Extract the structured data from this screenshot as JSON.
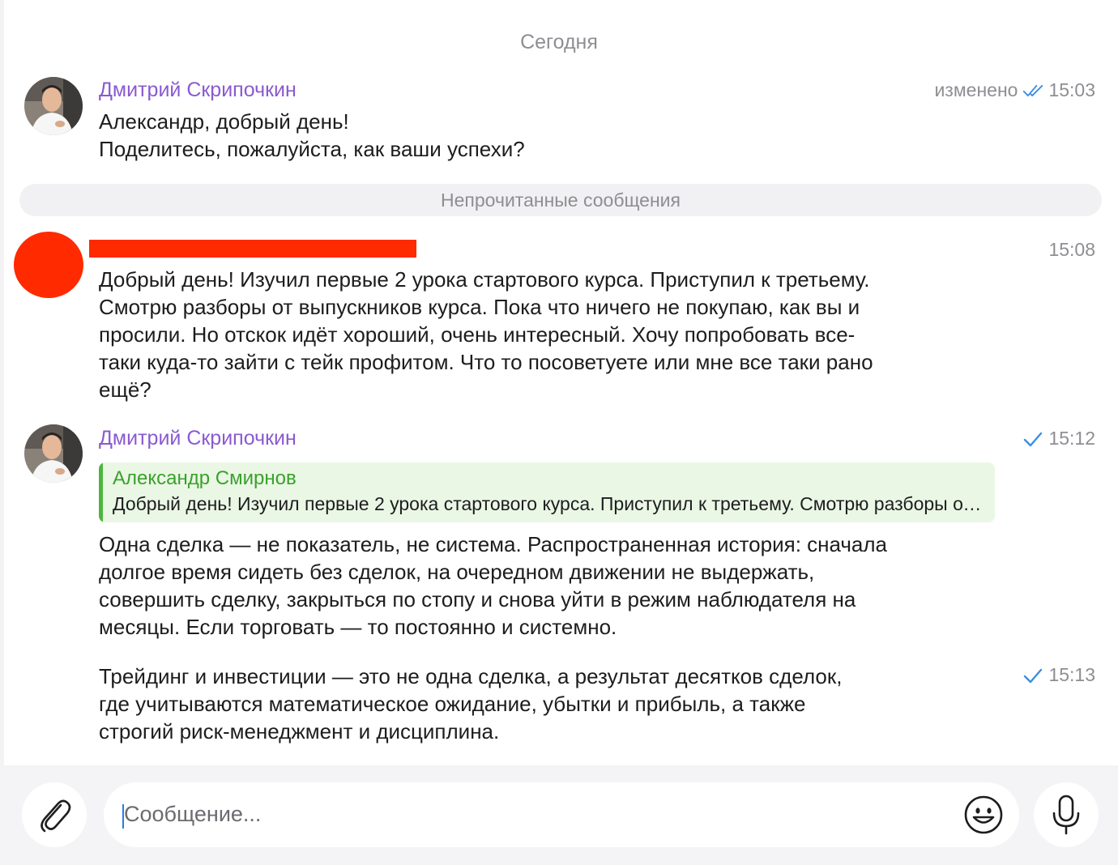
{
  "date_separator": "Сегодня",
  "unread_separator": "Непрочитанные сообщения",
  "messages": [
    {
      "sender": "Дмитрий Скрипочкин",
      "edited_label": "изменено",
      "time": "15:03",
      "status": "read",
      "text": "Александр, добрый день!\nПоделитесь, пожалуйста, как ваши успехи?"
    },
    {
      "sender": "",
      "time": "15:08",
      "text": "Добрый день! Изучил первые 2 урока стартового курса. Приступил к третьему.\nСмотрю разборы от выпускников курса. Пока что ничего не покупаю, как вы и\nпросили. Но отскок идёт хороший, очень интересный. Хочу попробовать все-\nтаки куда-то зайти с тейк профитом. Что то посоветуете или мне все таки рано\nещё?"
    },
    {
      "sender": "Дмитрий Скрипочкин",
      "time": "15:12",
      "status": "sent",
      "reply": {
        "name": "Александр Смирнов",
        "text": "Добрый день! Изучил первые 2 урока стартового курса. Приступил к третьему. Смотрю разборы от выпускников курса."
      },
      "text": "Одна сделка — не показатель, не система. Распространенная история: сначала\nдолгое время сидеть без сделок, на очередном движении не выдержать,\nсовершить сделку, закрыться по стопу и снова уйти в режим наблюдателя на\nмесяцы. Если торговать — то постоянно и системно."
    },
    {
      "time": "15:13",
      "status": "sent",
      "text": "Трейдинг и инвестиции — это не одна сделка, а результат десятков сделок,\nгде учитываются математическое ожидание, убытки и прибыль, а также\nстрогий риск-менеджмент и дисциплина."
    }
  ],
  "composer": {
    "placeholder": "Сообщение...",
    "attach_icon": "paperclip-icon",
    "emoji_icon": "emoji-icon",
    "mic_icon": "microphone-icon"
  },
  "colors": {
    "sender_name": "#8a5ad1",
    "check": "#3d8fe0",
    "reply_accent": "#4eb53f",
    "redaction": "#ff2a00"
  }
}
